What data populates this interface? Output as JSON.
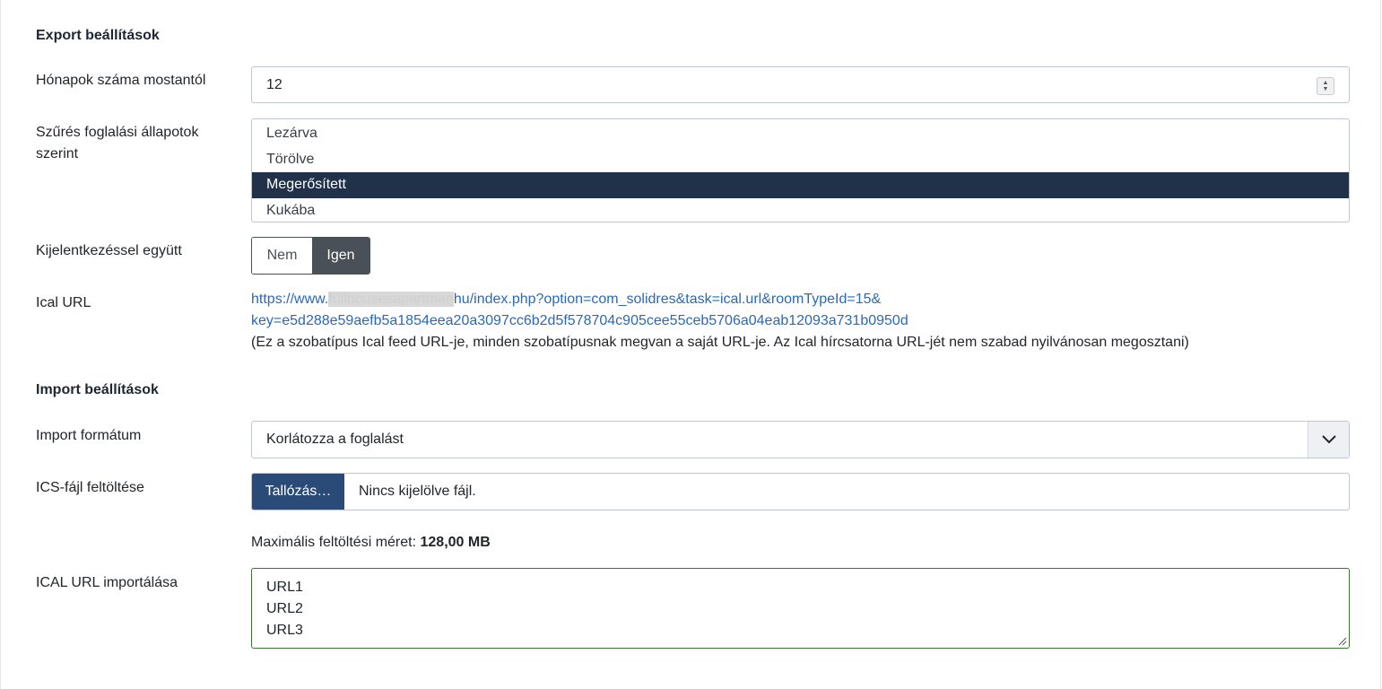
{
  "export": {
    "heading": "Export beállítások",
    "months_label": "Hónapok száma mostantól",
    "months_value": "12",
    "filter_label": "Szűrés foglalási állapotok szerint",
    "filter_options": [
      "Lezárva",
      "Törölve",
      "Megerősített",
      "Kukába"
    ],
    "filter_selected": "Megerősített",
    "checkout_label": "Kijelentkezéssel együtt",
    "checkout_no": "Nem",
    "checkout_yes": "Igen",
    "checkout_selected": "Igen",
    "ical_label": "Ical URL",
    "ical_url_prefix": "https://www.",
    "ical_url_hidden": "fullhousesapartman",
    "ical_url_rest": "hu/index.php?option=com_solidres&task=ical.url&roomTypeId=15&",
    "ical_url_line2": "key=e5d288e59aefb5a1854eea20a3097cc6b2d5f578704c905cee55ceb5706a04eab12093a731b0950d",
    "ical_note": "(Ez a szobatípus Ical feed URL-je, minden szobatípusnak megvan a saját URL-je. Az Ical hírcsatorna URL-jét nem szabad nyilvánosan megosztani)"
  },
  "import": {
    "heading": "Import beállítások",
    "format_label": "Import formátum",
    "format_value": "Korlátozza a foglalást",
    "file_label": "ICS-fájl feltöltése",
    "browse_label": "Tallózás…",
    "file_status": "Nincs kijelölve fájl.",
    "max_size_label": "Maximális feltöltési méret:",
    "max_size_value": "128,00 MB",
    "url_label": "ICAL URL importálása",
    "url_lines": [
      "URL1",
      "URL2",
      "URL3"
    ]
  },
  "colors": {
    "selected_bg": "#22314a",
    "link": "#2a69b8",
    "toggle_active": "#495057",
    "browse_bg": "#2a4a78",
    "textarea_border": "#3f6e3a"
  },
  "icons": [
    "spinner-icon",
    "chevron-down-icon",
    "resize-grip-icon"
  ]
}
